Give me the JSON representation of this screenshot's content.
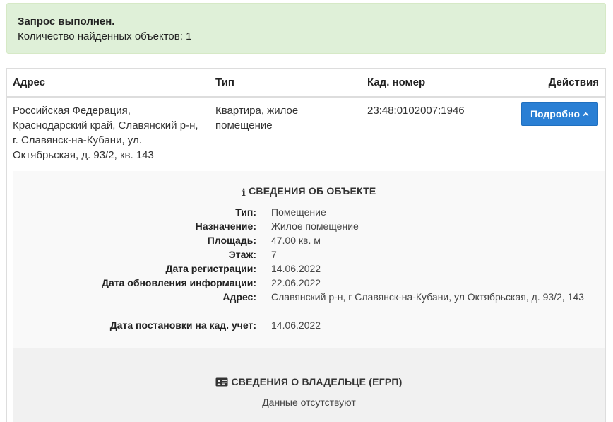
{
  "alert": {
    "title": "Запрос выполнен.",
    "text": "Количество найденных объектов: 1"
  },
  "table": {
    "headers": {
      "address": "Адрес",
      "type": "Тип",
      "cad": "Кад. номер",
      "actions": "Действия"
    },
    "row": {
      "address": "Российская Федерация, Краснодарский край, Славянский р-н, г. Славянск-на-Кубани, ул. Октябрьская, д. 93/2, кв. 143",
      "type": "Квартира, жилое помещение",
      "cad": "23:48:0102007:1946",
      "button": "Подробно"
    }
  },
  "object_info": {
    "title": "СВЕДЕНИЯ ОБ ОБЪЕКТЕ",
    "icon": "info-icon",
    "fields": [
      {
        "label": "Тип:",
        "value": "Помещение"
      },
      {
        "label": "Назначение:",
        "value": "Жилое помещение"
      },
      {
        "label": "Площадь:",
        "value": "47.00 кв. м"
      },
      {
        "label": "Этаж:",
        "value": "7"
      },
      {
        "label": "Дата регистрации:",
        "value": "14.06.2022"
      },
      {
        "label": "Дата обновления информации:",
        "value": "22.06.2022"
      },
      {
        "label": "Адрес:",
        "value": "Славянский р-н, г Славянск-на-Кубани, ул Октябрьская, д. 93/2, 143"
      },
      {
        "label": "Дата постановки на кад. учет:",
        "value": "14.06.2022"
      }
    ]
  },
  "owner_info": {
    "title": "СВЕДЕНИЯ О ВЛАДЕЛЬЦЕ (ЕГРП)",
    "icon": "id-card-icon",
    "empty_text": "Данные отсутствуют"
  },
  "colors": {
    "alert_bg": "#dff0d8",
    "button_bg": "#2a7fd4",
    "details_bg": "#f9f9f9"
  }
}
